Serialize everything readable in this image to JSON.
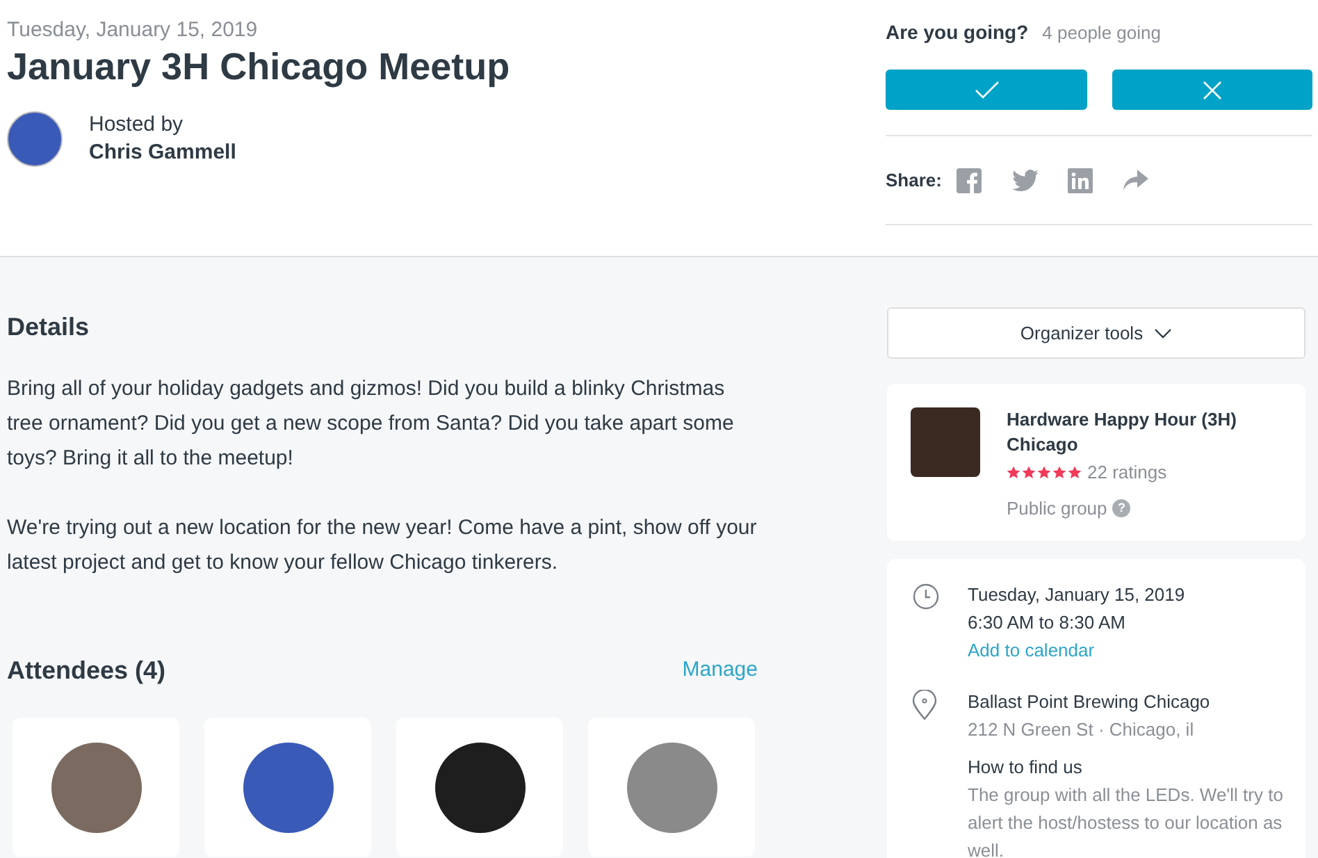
{
  "event": {
    "date": "Tuesday, January 15, 2019",
    "title": "January 3H Chicago Meetup",
    "hosted_by_label": "Hosted by",
    "host": "Chris Gammell"
  },
  "rsvp": {
    "question": "Are you going?",
    "count": "4 people going",
    "share_label": "Share:"
  },
  "details": {
    "heading": "Details",
    "paragraphs": [
      "Bring all of your holiday gadgets and gizmos! Did you build a blinky Christmas tree ornament? Did you get a new scope from Santa? Did you take apart some toys? Bring it all to the meetup!",
      "We're trying out a new location for the new year! Come have a pint, show off your latest project and get to know your fellow Chicago tinkerers."
    ]
  },
  "attendees": {
    "heading": "Attendees (4)",
    "manage": "Manage",
    "people": [
      {
        "kind": "photo"
      },
      {
        "kind": "photo"
      },
      {
        "kind": "photo"
      },
      {
        "kind": "photo"
      }
    ]
  },
  "organizer_tools": "Organizer tools",
  "group": {
    "name": "Hardware Happy Hour (3H) Chicago",
    "stars": 5,
    "ratings": "22 ratings",
    "visibility": "Public group",
    "help": "?"
  },
  "when": {
    "date": "Tuesday, January 15, 2019",
    "time": "6:30 AM to 8:30 AM",
    "add_to_calendar": "Add to calendar"
  },
  "where": {
    "venue": "Ballast Point Brewing Chicago",
    "address": "212 N Green St · Chicago, il",
    "how_heading": "How to find us",
    "how_text": "The group with all the LEDs. We'll try to alert the host/hostess to our location as well."
  }
}
